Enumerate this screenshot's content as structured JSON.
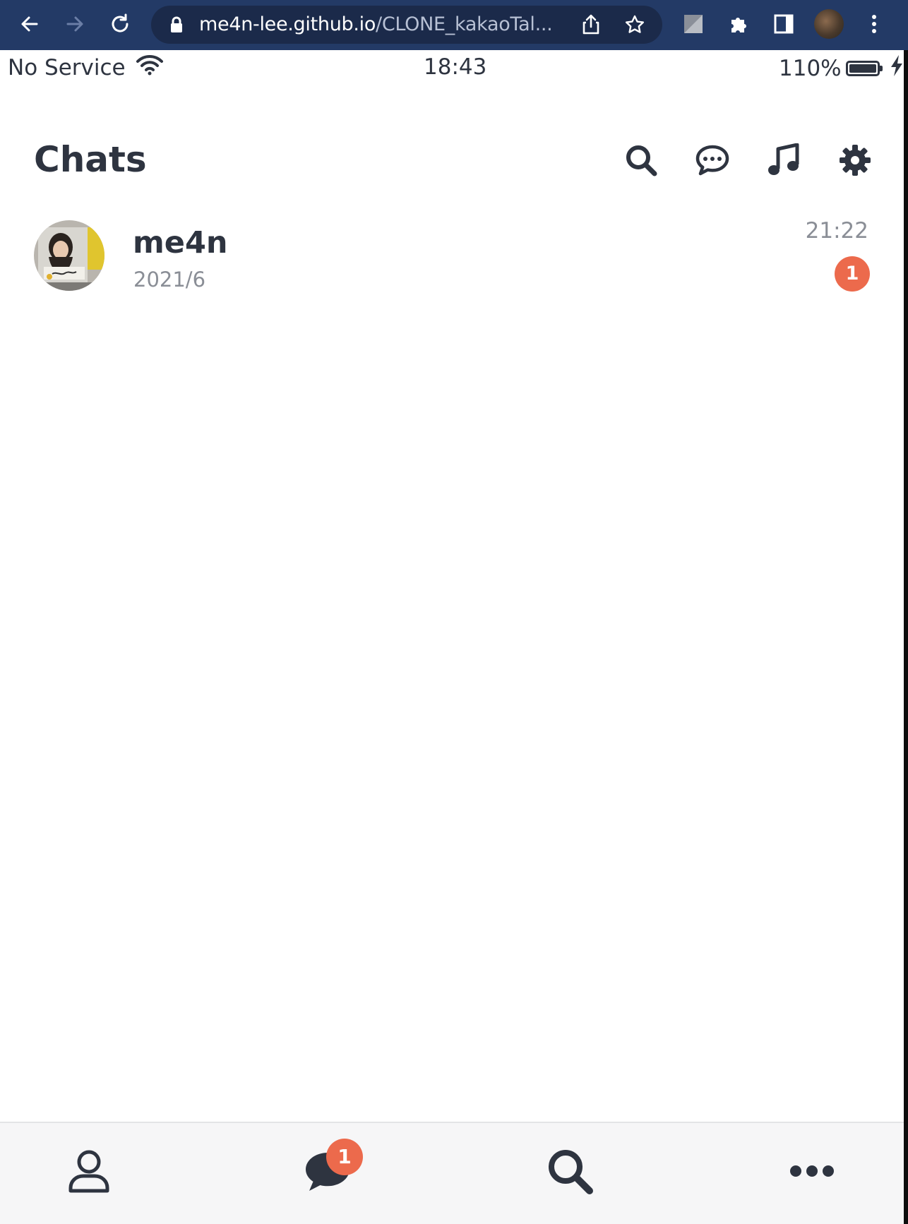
{
  "browser": {
    "url_host": "me4n-lee.github.io",
    "url_path": "/CLONE_kakaoTal...",
    "icons": [
      "back-icon",
      "forward-icon",
      "reload-icon",
      "lock-icon",
      "share-icon",
      "bookmark-star-icon",
      "extension-tile-icon",
      "puzzle-icon",
      "sidepanel-icon",
      "profile-avatar",
      "kebab-menu-icon"
    ]
  },
  "status_bar": {
    "carrier": "No Service",
    "time": "18:43",
    "battery": "110%"
  },
  "header": {
    "title": "Chats",
    "icons": [
      "search-icon",
      "chat-bubble-icon",
      "music-note-icon",
      "gear-icon"
    ]
  },
  "chats": [
    {
      "name": "me4n",
      "preview": "2021/6",
      "time": "21:22",
      "unread": "1"
    }
  ],
  "tab_bar": {
    "tabs": [
      "person-icon",
      "chat-icon",
      "search-icon",
      "more-dots-icon"
    ],
    "chat_badge": "1"
  },
  "colors": {
    "browser_bar": "#233a66",
    "text_dark": "#2e3440",
    "text_muted": "#8a8e96",
    "badge": "#ec6a4c",
    "tab_bar_bg": "#f6f6f7"
  }
}
